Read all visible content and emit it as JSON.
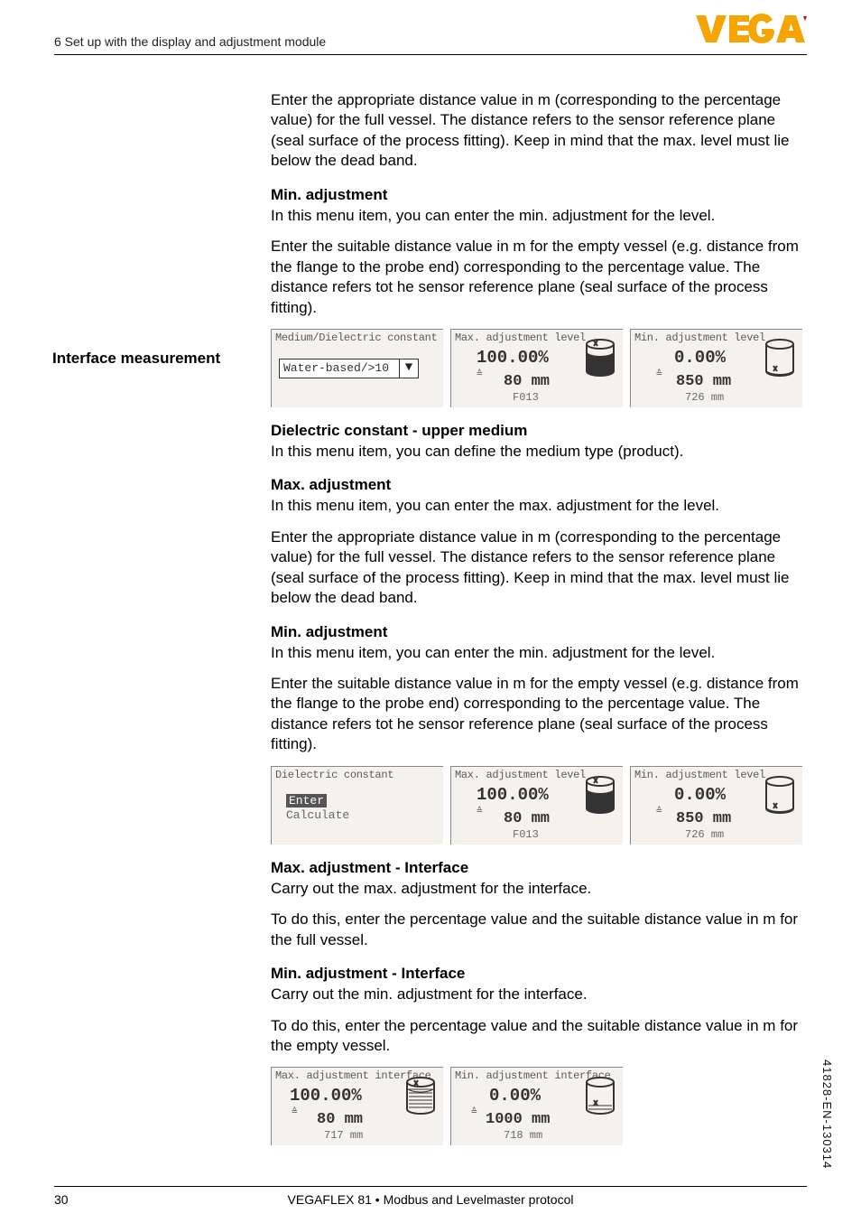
{
  "header": {
    "section": "6 Set up with the display and adjustment module"
  },
  "logo": {
    "text": "VEGA"
  },
  "para1": "Enter the appropriate distance value in m (corresponding to the percentage value) for the full vessel. The distance refers to the sensor reference plane (seal surface of the process fitting). Keep in mind that the max. level must lie below the dead band.",
  "min_adj_h": "Min. adjustment",
  "min_adj_p1": "In this menu item, you can enter the min. adjustment for the level.",
  "min_adj_p2": "Enter the suitable distance value in m for the empty vessel (e.g. distance from the flange to the probe end) corresponding to the percentage value. The distance refers tot he sensor reference plane (seal surface of the process fitting).",
  "lcd_set1": {
    "l1": {
      "title": "Medium/Dielectric constant",
      "value": "Water-based/>10"
    },
    "l2": {
      "title": "Max. adjustment level",
      "pct": "100.00%",
      "dist": "80 mm",
      "code": "F013"
    },
    "l3": {
      "title": "Min. adjustment level",
      "pct": "0.00%",
      "dist": "850 mm",
      "code": "726 mm"
    }
  },
  "side_label_1": "Interface measurement",
  "dc_upper_h": "Dielectric constant - upper medium",
  "dc_upper_p": "In this menu item, you can define the medium type (product).",
  "max_adj_h": "Max. adjustment",
  "max_adj_p1": "In this menu item, you can enter the max. adjustment for the level.",
  "max_adj_p2": "Enter the appropriate distance value in m (corresponding to the percentage value) for the full vessel. The distance refers to the sensor reference plane (seal surface of the process fitting). Keep in mind that the max. level must lie below the dead band.",
  "min_adj_h2": "Min. adjustment",
  "min_adj_p3": "In this menu item, you can enter the min. adjustment for the level.",
  "min_adj_p4": "Enter the suitable distance value in m for the empty vessel (e.g. distance from the flange to the probe end) corresponding to the percentage value. The distance refers tot he sensor reference plane (seal surface of the process fitting).",
  "lcd_set2": {
    "l1": {
      "title": "Dielectric constant",
      "opt1": "Enter",
      "opt2": "Calculate"
    },
    "l2": {
      "title": "Max. adjustment level",
      "pct": "100.00%",
      "dist": "80 mm",
      "code": "F013"
    },
    "l3": {
      "title": "Min. adjustment level",
      "pct": "0.00%",
      "dist": "850 mm",
      "code": "726 mm"
    }
  },
  "max_int_h": "Max. adjustment - Interface",
  "max_int_p1": "Carry out the max. adjustment for the interface.",
  "max_int_p2": "To do this, enter the percentage value and the suitable distance value in m for the full vessel.",
  "min_int_h": "Min. adjustment - Interface",
  "min_int_p1": "Carry out the min. adjustment for the interface.",
  "min_int_p2": "To do this, enter the percentage value and the suitable distance value in m for the empty vessel.",
  "lcd_set3": {
    "l1": {
      "title": "Max. adjustment interface",
      "pct": "100.00%",
      "dist": "80 mm",
      "code": "717 mm"
    },
    "l2": {
      "title": "Min. adjustment interface",
      "pct": "0.00%",
      "dist": "1000 mm",
      "code": "718 mm"
    }
  },
  "footer": {
    "page": "30",
    "product": "VEGAFLEX 81 • Modbus and Levelmaster protocol"
  },
  "docnum": "41828-EN-130314"
}
